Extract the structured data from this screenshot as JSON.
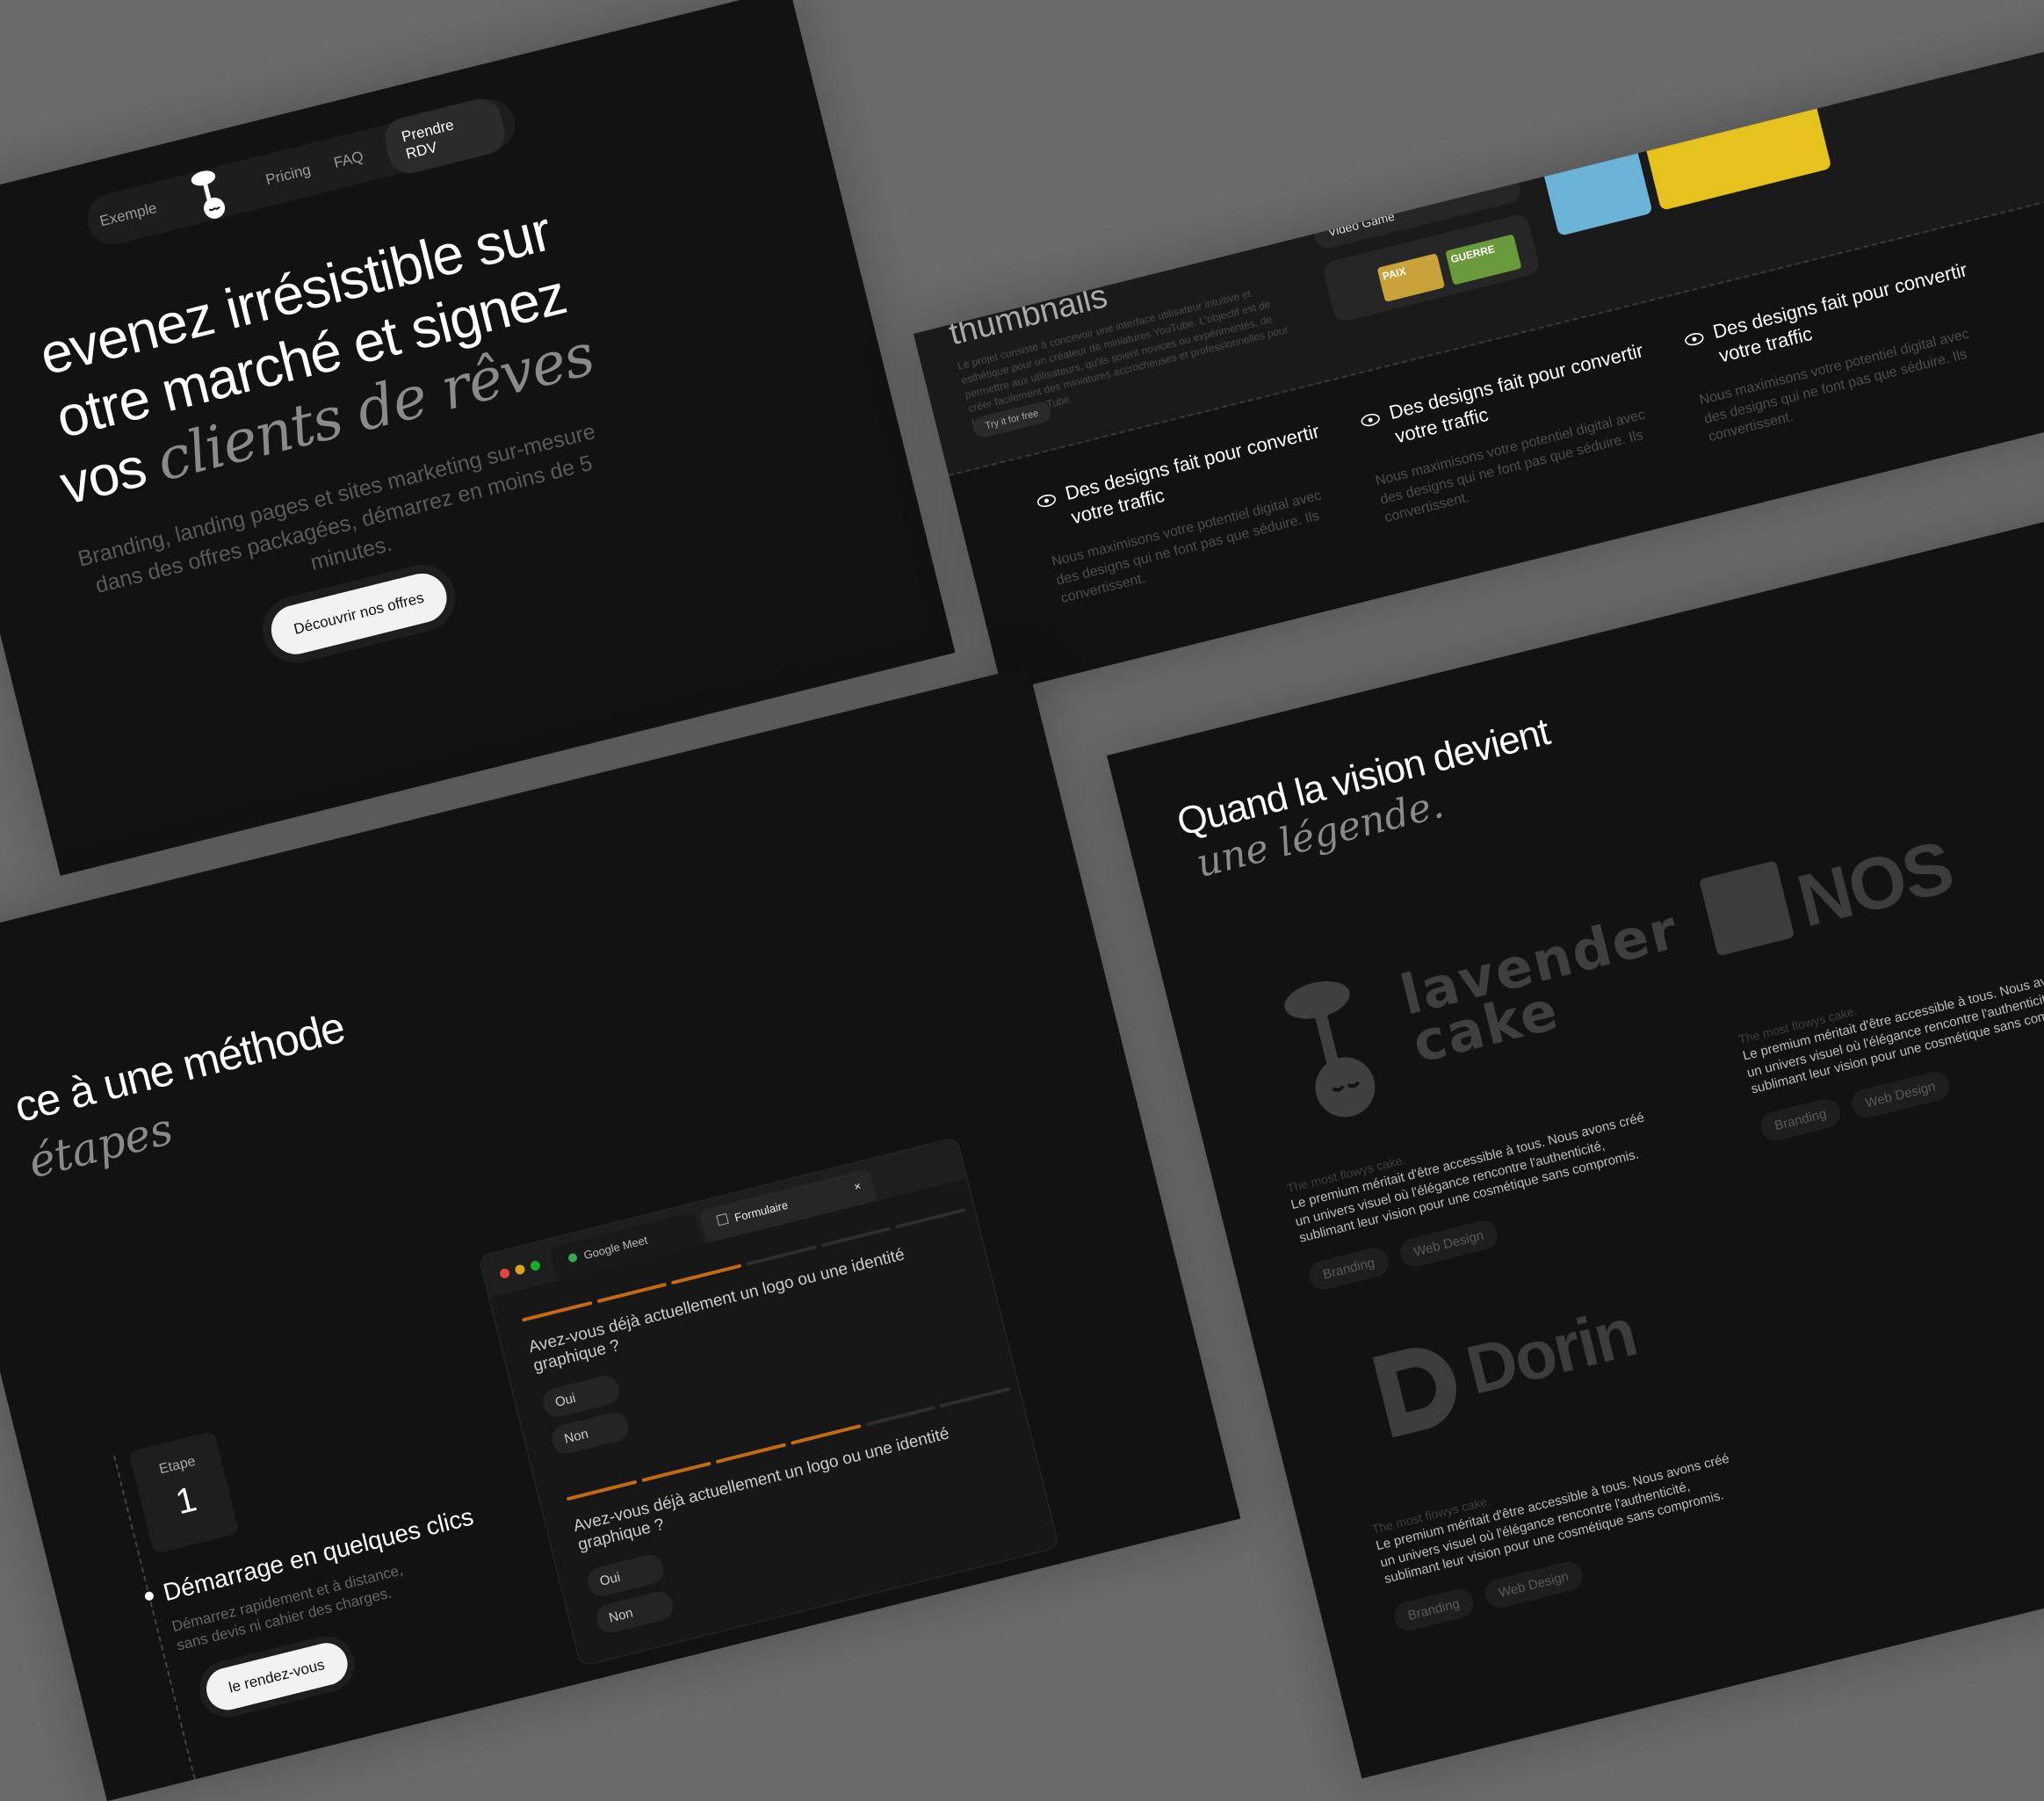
{
  "hero": {
    "nav": {
      "example": "Exemple",
      "pricing": "Pricing",
      "faq": "FAQ",
      "cta": "Prendre RDV"
    },
    "headline_line1": "evenez irrésistible sur",
    "headline_line2": "otre marché et signez",
    "headline_line3_plain": "vos",
    "headline_line3_serif": "clients de rêves",
    "subtitle": "Branding, landing pages et sites marketing sur-mesure dans des offres packagées, démarrez en moins de 5 minutes.",
    "button": "Découvrir nos offres"
  },
  "features": {
    "top_title": "thumbnails",
    "top_desc": "Le projet consiste à concevoir une interface utilisateur intuitive et esthétique pour un créateur de miniatures YouTube. L'objectif est de permettre aux utilisateurs, qu'ils soient novices ou expérimentés, de créer facilement des miniatures accrocheuses et professionnelles pour leurs vidéos YouTube.",
    "try_button": "Try it for free",
    "card_label": "Video Game",
    "thumb_text_1": "PAIX",
    "thumb_text_2": "GUERRE",
    "items": [
      {
        "title": "Des designs fait pour convertir votre traffic",
        "desc": "Nous maximisons votre potentiel digital avec des designs qui ne font pas que séduire. Ils convertissent."
      },
      {
        "title": "Des designs fait pour convertir votre traffic",
        "desc": "Nous maximisons votre potentiel digital avec des designs qui ne font pas que séduire. Ils convertissent."
      },
      {
        "title": "Des designs fait pour convertir votre traffic",
        "desc": "Nous maximisons votre potentiel digital avec des designs qui ne font pas que séduire. Ils convertissent."
      }
    ]
  },
  "method": {
    "heading_plain": "ce à une méthode",
    "heading_serif": "étapes",
    "step_label": "Etape",
    "step_number": "1",
    "step_title": "Démarrage en quelques clics",
    "step_desc": "Démarrez rapidement et à distance, sans devis ni cahier des charges.",
    "step_button": "le rendez-vous",
    "browser": {
      "tab1": "Google Meet",
      "tab2": "Formulaire",
      "close": "×",
      "question": "Avez-vous déjà actuellement un logo ou une identité graphique ?",
      "option_yes": "Oui",
      "option_no": "Non"
    }
  },
  "portfolio": {
    "heading_plain": "Quand la vision devient",
    "heading_serif": "une légende.",
    "brand_lavender_line1": "lavender",
    "brand_lavender_line2": "cake",
    "brand_nos": "NOS",
    "brand_dorin": "Dorin",
    "item_title": "The most flowys cake.",
    "item_desc": "Le premium méritait d'être accessible à tous. Nous avons créé un univers visuel où l'élégance rencontre l'authenticité, sublimant leur vision pour une cosmétique sans compromis.",
    "tag_branding": "Branding",
    "tag_webdesign": "Web Design"
  },
  "colors": {
    "background": "#6a6a6a",
    "panel": "#121212",
    "accent_progress": "#c46a12"
  }
}
